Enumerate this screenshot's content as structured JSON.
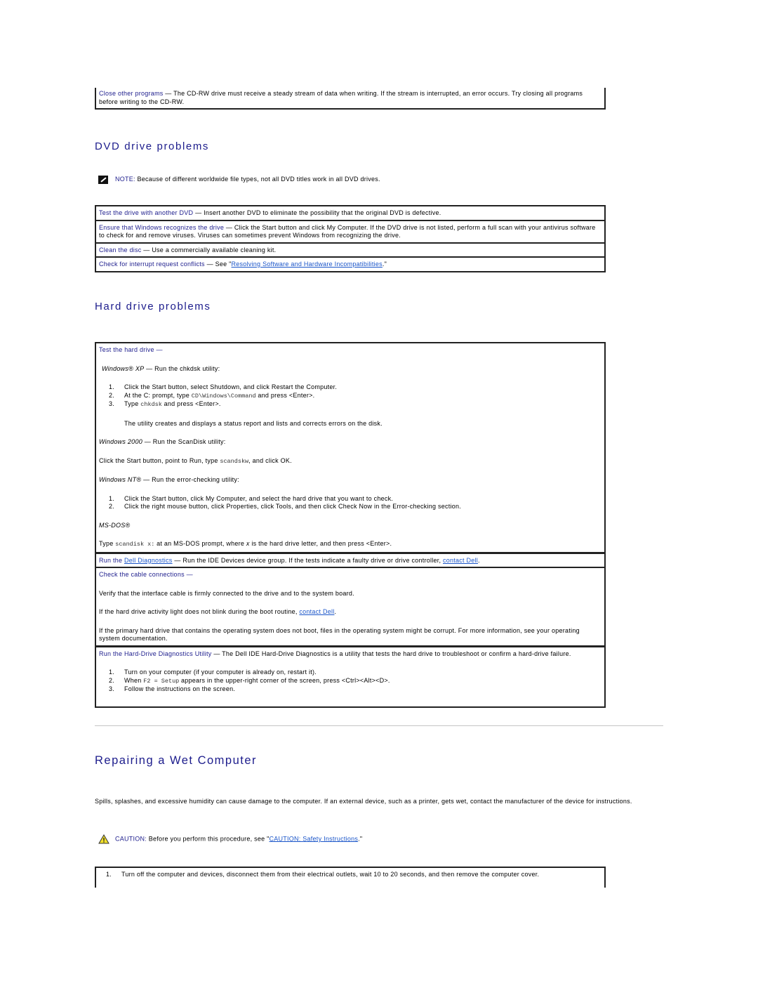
{
  "top_box": {
    "title": "Close other programs",
    "dash": " — ",
    "text": "The CD-RW drive must receive a steady stream of data when writing. If the stream is interrupted, an error occurs. Try closing all programs before writing to the CD-RW."
  },
  "dvd": {
    "heading": "DVD drive problems",
    "note_label": "NOTE:",
    "note_text": " Because of different worldwide file types, not all DVD titles work in all DVD drives.",
    "rows": [
      {
        "title": "Test the drive with another DVD",
        "text": "Insert another DVD to eliminate the possibility that the original DVD is defective."
      },
      {
        "title": "Ensure that Windows recognizes the drive",
        "text": "Click the Start button and click My Computer. If the DVD drive is not listed, perform a full scan with your antivirus software to check for and remove viruses. Viruses can sometimes prevent Windows from recognizing the drive."
      },
      {
        "title": "Clean the disc",
        "text": "Use a commercially available cleaning kit."
      },
      {
        "title": "Check for interrupt request conflicts",
        "text_before": "See \"",
        "link": "Resolving Software and Hardware Incompatibilities",
        "text_after": ".\""
      }
    ]
  },
  "hdd": {
    "heading": "Hard drive problems",
    "test": {
      "title": "Test the hard drive",
      "xp_label": "Windows® XP",
      "xp_text": " — Run the chkdsk utility:",
      "xp_steps": [
        {
          "num": "1.",
          "text": "Click the Start button, select Shutdown, and click Restart the Computer."
        },
        {
          "num": "2.",
          "before": "At the C: prompt, type ",
          "code": "CD\\Windows\\Command",
          "after": " and press <Enter>."
        },
        {
          "num": "3.",
          "before": "Type ",
          "code": "chkdsk",
          "after": " and press <Enter>."
        }
      ],
      "xp_result": "The utility creates and displays a status report and lists and corrects errors on the disk.",
      "w2k_label": "Windows 2000",
      "w2k_text": " — Run the ScanDisk utility:",
      "w2k_before": "Click the Start button, point to Run, type ",
      "w2k_code": "scandskw",
      "w2k_after": ", and click OK.",
      "nt_label": "Windows NT®",
      "nt_text": " — Run the error-checking utility:",
      "nt_steps": [
        {
          "num": "1.",
          "text": "Click the Start button, click My Computer, and select the hard drive that you want to check."
        },
        {
          "num": "2.",
          "text": "Click the right mouse button, click Properties, click Tools, and then click Check Now in the Error-checking section."
        }
      ],
      "dos_label": "MS-DOS®",
      "dos_before": "Type ",
      "dos_code": "scandisk x:",
      "dos_mid": " at an MS-DOS prompt, where ",
      "dos_x": "x",
      "dos_after": " is the hard drive letter, and then press <Enter>."
    },
    "diag": {
      "title_before": "Run the ",
      "link": "Dell Diagnostics",
      "text": "Run the IDE Devices device group. If the tests indicate a faulty drive or drive controller, ",
      "link2": "contact Dell",
      "end": "."
    },
    "cable": {
      "title": "Check the cable connections",
      "p1": "Verify that the interface cable is firmly connected to the drive and to the system board.",
      "p2_before": "If the hard drive activity light does not blink during the boot routine, ",
      "p2_link": "contact Dell",
      "p2_end": ".",
      "p3": "If the primary hard drive that contains the operating system does not boot, files in the operating system might be corrupt. For more information, see your operating system documentation."
    },
    "hdd_diag": {
      "title": "Run the Hard-Drive Diagnostics Utility",
      "text": "The Dell IDE Hard-Drive Diagnostics is a utility that tests the hard drive to troubleshoot or confirm a hard-drive failure.",
      "steps": [
        {
          "num": "1.",
          "text": "Turn on your computer (if your computer is already on, restart it)."
        },
        {
          "num": "2.",
          "before": "When ",
          "code": "F2 = Setup",
          "after": " appears in the upper-right corner of the screen, press <Ctrl><Alt><D>."
        },
        {
          "num": "3.",
          "text": "Follow the instructions on the screen."
        }
      ]
    }
  },
  "wet": {
    "heading": "Repairing a Wet Computer",
    "intro": "Spills, splashes, and excessive humidity can cause damage to the computer. If an external device, such as a printer, gets wet, contact the manufacturer of the device for instructions.",
    "caution_label": "CAUTION:",
    "caution_before": " Before you perform this procedure, see \"",
    "caution_link": "CAUTION: Safety Instructions",
    "caution_after": ".\"",
    "steps": [
      {
        "num": "1.",
        "text": "Turn off the computer and devices, disconnect them from their electrical outlets, wait 10 to 20 seconds, and then remove the computer cover."
      }
    ]
  },
  "dash": " — "
}
